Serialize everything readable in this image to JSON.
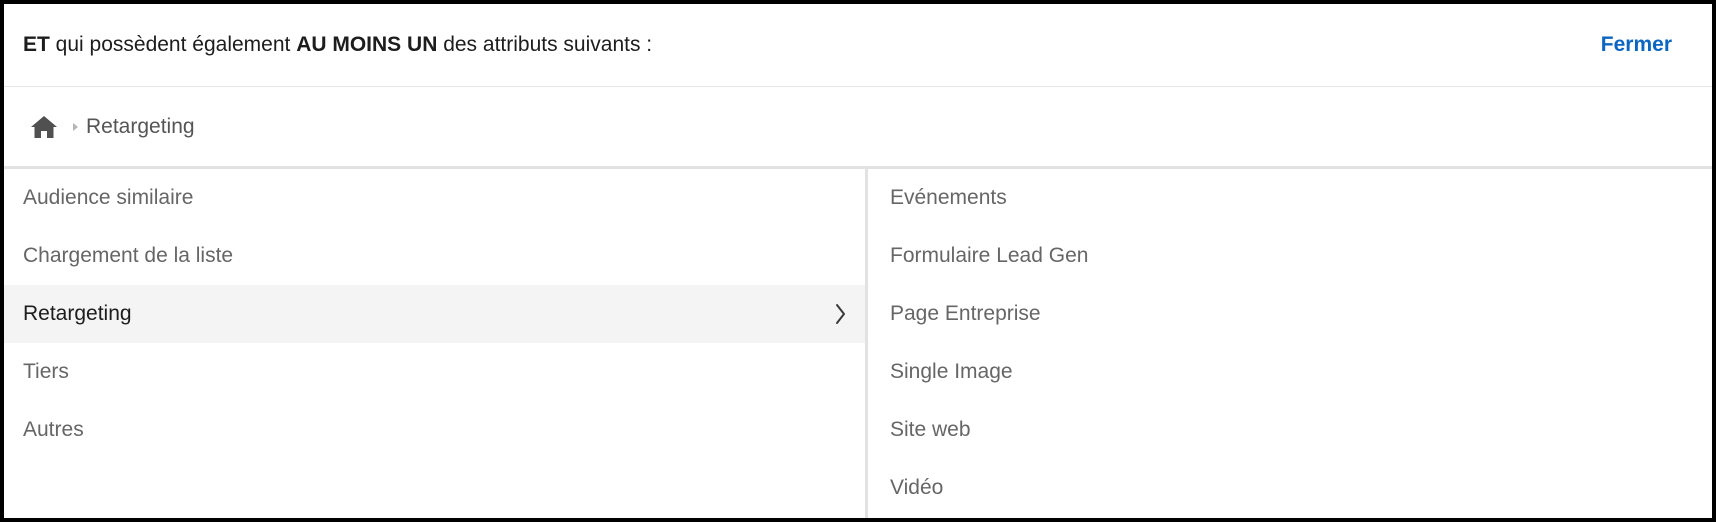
{
  "colors": {
    "accent": "#0a66c2",
    "text_dark": "#1d1d1d",
    "text_muted": "#666666",
    "selected_bg": "#f4f4f5"
  },
  "header": {
    "prefix_bold": "ET",
    "middle": " qui possèdent également ",
    "emphasis_bold": "AU MOINS UN",
    "suffix": " des attributs suivants :",
    "close_label": "Fermer"
  },
  "breadcrumb": {
    "home_icon": "home-icon",
    "current": "Retargeting"
  },
  "categories": [
    {
      "label": "Audience similaire"
    },
    {
      "label": "Chargement de la liste"
    },
    {
      "label": "Retargeting",
      "selected": true,
      "icon": "chevron-right-icon"
    },
    {
      "label": "Tiers"
    },
    {
      "label": "Autres"
    }
  ],
  "subcategories": [
    {
      "label": "Evénements"
    },
    {
      "label": "Formulaire Lead Gen"
    },
    {
      "label": "Page Entreprise"
    },
    {
      "label": "Single Image"
    },
    {
      "label": "Site web"
    },
    {
      "label": "Vidéo"
    }
  ]
}
